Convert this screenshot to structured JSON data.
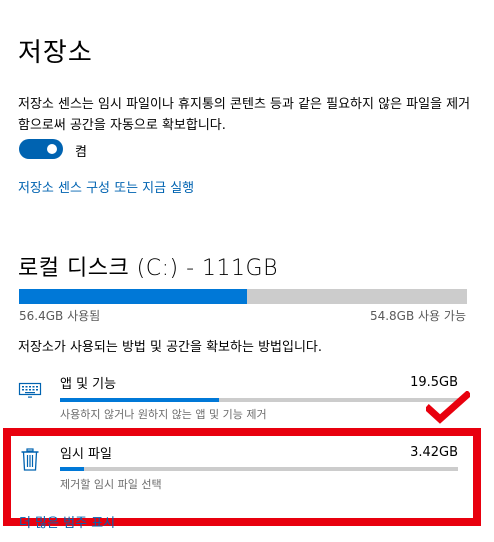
{
  "page": {
    "title": "저장소",
    "description": "저장소 센스는 임시 파일이나 휴지통의 콘텐츠 등과 같은 필요하지 않은 파일을 제거함으로써 공간을 자동으로 확보합니다.",
    "toggle": {
      "state_label": "켬",
      "on": true
    },
    "configure_link": "저장소 센스 구성 또는 지금 실행"
  },
  "disk": {
    "title": "로컬 디스크 (C:) - 111GB",
    "used_label": "56.4GB 사용됨",
    "free_label": "54.8GB 사용 가능",
    "used_fraction": 0.508,
    "usage_description": "저장소가 사용되는 방법 및 공간을 확보하는 방법입니다."
  },
  "categories": [
    {
      "title": "앱 및 기능",
      "size": "19.5GB",
      "subtitle": "사용하지 않거나 원하지 않는 앱 및 기능 제거",
      "fraction": 0.4,
      "icon": "keyboard-icon"
    },
    {
      "title": "임시 파일",
      "size": "3.42GB",
      "subtitle": "제거할 임시 파일 선택",
      "fraction": 0.06,
      "icon": "trash-icon"
    }
  ],
  "more_link": "더 많은 범주 표시",
  "colors": {
    "accent": "#0063b1",
    "bar_fill": "#0078d7",
    "bar_track": "#cccccc",
    "highlight_red": "#e8000e"
  }
}
